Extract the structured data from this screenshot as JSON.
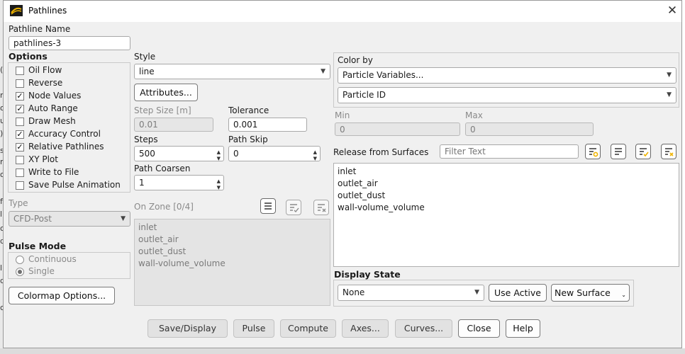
{
  "window": {
    "title": "Pathlines",
    "close_glyph": "✕"
  },
  "pathline_name": {
    "label": "Pathline Name",
    "value": "pathlines-3"
  },
  "options": {
    "header": "Options",
    "items": [
      {
        "label": "Oil Flow",
        "checked": false
      },
      {
        "label": "Reverse",
        "checked": false
      },
      {
        "label": "Node Values",
        "checked": true
      },
      {
        "label": "Auto Range",
        "checked": true
      },
      {
        "label": "Draw Mesh",
        "checked": false
      },
      {
        "label": "Accuracy Control",
        "checked": true
      },
      {
        "label": "Relative Pathlines",
        "checked": true
      },
      {
        "label": "XY Plot",
        "checked": false
      },
      {
        "label": "Write to File",
        "checked": false
      },
      {
        "label": "Save Pulse Animation",
        "checked": false
      }
    ]
  },
  "type": {
    "label": "Type",
    "value": "CFD-Post"
  },
  "pulse_mode": {
    "header": "Pulse Mode",
    "options": [
      {
        "label": "Continuous",
        "selected": false
      },
      {
        "label": "Single",
        "selected": true
      }
    ]
  },
  "colormap_button": "Colormap Options...",
  "style": {
    "label": "Style",
    "value": "line",
    "attributes_button": "Attributes..."
  },
  "step_size": {
    "label": "Step Size [m]",
    "value": "0.01"
  },
  "tolerance": {
    "label": "Tolerance",
    "value": "0.001"
  },
  "steps": {
    "label": "Steps",
    "value": "500"
  },
  "path_skip": {
    "label": "Path Skip",
    "value": "0"
  },
  "path_coarsen": {
    "label": "Path Coarsen",
    "value": "1"
  },
  "on_zone": {
    "label": "On Zone [0/4]",
    "items": [
      "inlet",
      "outlet_air",
      "outlet_dust",
      "wall-volume_volume"
    ]
  },
  "color_by": {
    "label": "Color by",
    "primary": "Particle Variables...",
    "secondary": "Particle ID"
  },
  "range": {
    "min_label": "Min",
    "min_value": "0",
    "max_label": "Max",
    "max_value": "0"
  },
  "release": {
    "label": "Release from Surfaces",
    "filter_placeholder": "Filter Text",
    "items": [
      "inlet",
      "outlet_air",
      "outlet_dust",
      "wall-volume_volume"
    ]
  },
  "display_state": {
    "header": "Display State",
    "value": "None",
    "use_active": "Use Active",
    "new_surface": "New Surface"
  },
  "footer": {
    "save_display": "Save/Display",
    "pulse": "Pulse",
    "compute": "Compute",
    "axes": "Axes...",
    "curves": "Curves...",
    "close": "Close",
    "help": "Help"
  },
  "colors": {
    "window_bg": "#f0f0f0",
    "disabled_bg": "#e4e4e4",
    "icon_accent": "#f0b400"
  }
}
